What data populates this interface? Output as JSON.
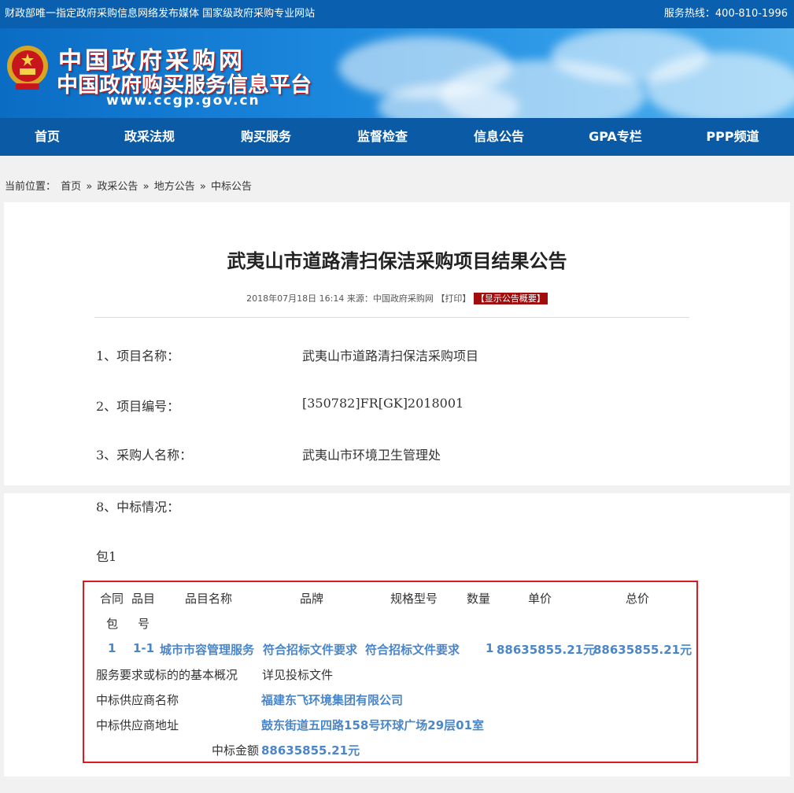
{
  "topbar": {
    "left_text": "财政部唯一指定政府采购信息网络发布媒体 国家级政府采购专业网站",
    "right_text": "服务热线：400-810-1996"
  },
  "banner": {
    "title": "中国政府采购网",
    "subtitle": "中国政府购买服务信息平台",
    "url": "www.ccgp.gov.cn"
  },
  "nav": {
    "items": [
      "首页",
      "政采法规",
      "购买服务",
      "监督检查",
      "信息公告",
      "GPA专栏",
      "PPP频道"
    ]
  },
  "breadcrumb": {
    "prefix": "当前位置：",
    "items": [
      "首页",
      "»",
      "政采公告",
      "»",
      "地方公告",
      "»",
      "中标公告"
    ]
  },
  "article": {
    "title": "武夷山市道路清扫保洁采购项目结果公告",
    "meta_date": "2018年07月18日 16:14",
    "meta_source": "来源：中国政府采购网",
    "meta_print": "【打印】",
    "meta_badge": "【显示公告概要】",
    "fields": [
      {
        "label": "1、项目名称：",
        "value": "武夷山市道路清扫保洁采购项目"
      },
      {
        "label": "2、项目编号：",
        "value": "[350782]FR[GK]2018001"
      },
      {
        "label": "3、采购人名称：",
        "value": "武夷山市环境卫生管理处"
      }
    ],
    "section8_label": "8、中标情况：",
    "package_label": "包1"
  },
  "result_table": {
    "headers": {
      "contract_pkg_line1": "合同",
      "contract_pkg_line2": "包",
      "item_no_line1": "品目",
      "item_no_line2": "号",
      "item_name": "品目名称",
      "brand": "品牌",
      "spec": "规格型号",
      "quantity": "数量",
      "unit_price": "单价",
      "total_price": "总价"
    },
    "row": {
      "contract_pkg": "1",
      "item_no": "1-1",
      "item_name": "城市市容管理服务",
      "brand": "符合招标文件要求",
      "spec": "符合招标文件要求",
      "quantity": "1",
      "unit_price": "88635855.21元",
      "total_price": "88635855.21元"
    },
    "requirements_label": "服务要求或标的的基本概况",
    "requirements_value": "详见投标文件",
    "supplier_name_label": "中标供应商名称",
    "supplier_name_value": "福建东飞环境集团有限公司",
    "supplier_addr_label": "中标供应商地址",
    "supplier_addr_value": "鼓东街道五四路158号环球广场29层01室",
    "amount_label": "中标金额",
    "amount_value": "88635855.21元"
  },
  "colors": {
    "topbar": "#0a5fae",
    "nav": "#0b5aa6",
    "accent_red": "#e0191f",
    "link_blue": "#4a86c8"
  }
}
